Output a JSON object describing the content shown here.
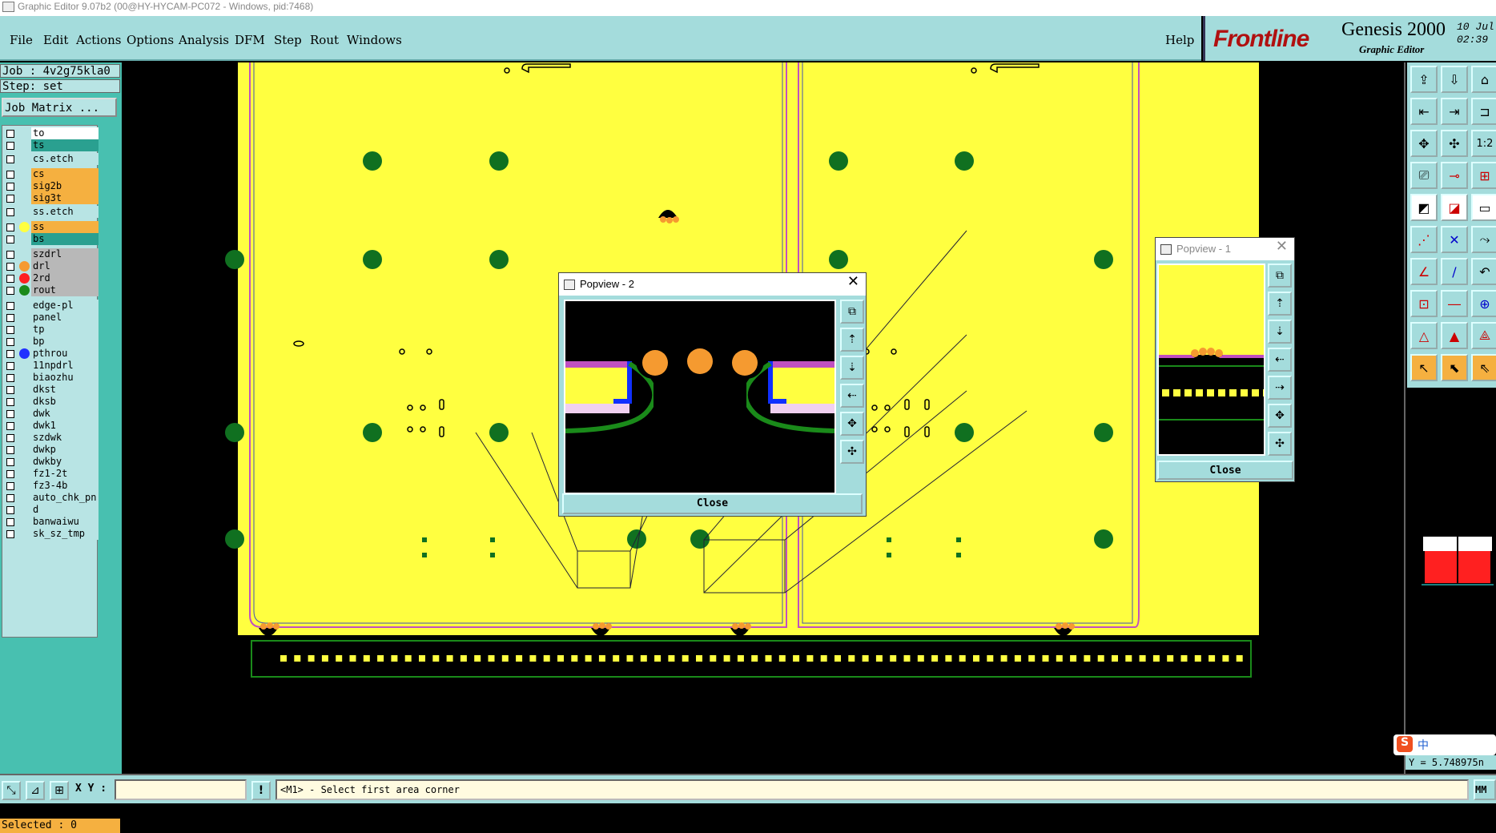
{
  "window": {
    "title": "Graphic Editor 9.07b2 (00@HY-HYCAM-PC072 - Windows, pid:7468)"
  },
  "menu": {
    "items": [
      "File",
      "Edit",
      "Actions",
      "Options",
      "Analysis",
      "DFM",
      "Step",
      "Rout",
      "Windows"
    ],
    "help": "Help"
  },
  "brand": {
    "logo": "Frontline",
    "product": "Genesis 2000",
    "subtitle": "Graphic Editor",
    "date": "10 Jul",
    "time": "02:39"
  },
  "left": {
    "job": "Job : 4v2g75kla0",
    "step": "Step: set",
    "matrix_button": "Job Matrix ...",
    "layers": [
      {
        "name": "to",
        "bg": "#ffffff",
        "dot": ""
      },
      {
        "name": "ts",
        "bg": "#2aa090",
        "dot": ""
      },
      {
        "name": "cs.etch",
        "bg": "#b8e4e4",
        "dot": ""
      },
      {
        "name": "cs",
        "bg": "#f5b040",
        "dot": ""
      },
      {
        "name": "sig2b",
        "bg": "#f5b040",
        "dot": ""
      },
      {
        "name": "sig3t",
        "bg": "#f5b040",
        "dot": ""
      },
      {
        "name": "ss.etch",
        "bg": "#b8e4e4",
        "dot": ""
      },
      {
        "name": "ss",
        "bg": "#f5b040",
        "dot": "#ffff40"
      },
      {
        "name": "bs",
        "bg": "#2aa090",
        "dot": ""
      },
      {
        "name": "szdrl",
        "bg": "#b8b8b8",
        "dot": ""
      },
      {
        "name": "drl",
        "bg": "#b8b8b8",
        "dot": "#f59a30"
      },
      {
        "name": "2rd",
        "bg": "#b8b8b8",
        "dot": "#ff2020"
      },
      {
        "name": "rout",
        "bg": "#b8b8b8",
        "dot": "#1a8a1a"
      },
      {
        "name": "edge-pl",
        "bg": "#b8e4e4",
        "dot": ""
      },
      {
        "name": "panel",
        "bg": "#b8e4e4",
        "dot": ""
      },
      {
        "name": "tp",
        "bg": "#b8e4e4",
        "dot": ""
      },
      {
        "name": "bp",
        "bg": "#b8e4e4",
        "dot": ""
      },
      {
        "name": "pthrou",
        "bg": "#b8e4e4",
        "dot": "#2030ff"
      },
      {
        "name": "11npdrl",
        "bg": "#b8e4e4",
        "dot": ""
      },
      {
        "name": "biaozhu",
        "bg": "#b8e4e4",
        "dot": ""
      },
      {
        "name": "dkst",
        "bg": "#b8e4e4",
        "dot": ""
      },
      {
        "name": "dksb",
        "bg": "#b8e4e4",
        "dot": ""
      },
      {
        "name": "dwk",
        "bg": "#b8e4e4",
        "dot": ""
      },
      {
        "name": "dwk1",
        "bg": "#b8e4e4",
        "dot": ""
      },
      {
        "name": "szdwk",
        "bg": "#b8e4e4",
        "dot": ""
      },
      {
        "name": "dwkp",
        "bg": "#b8e4e4",
        "dot": ""
      },
      {
        "name": "dwkby",
        "bg": "#b8e4e4",
        "dot": ""
      },
      {
        "name": "fz1-2t",
        "bg": "#b8e4e4",
        "dot": ""
      },
      {
        "name": "fz3-4b",
        "bg": "#b8e4e4",
        "dot": ""
      },
      {
        "name": "auto_chk_pn",
        "bg": "#b8e4e4",
        "dot": ""
      },
      {
        "name": "d",
        "bg": "#b8e4e4",
        "dot": ""
      },
      {
        "name": "banwaiwu",
        "bg": "#b8e4e4",
        "dot": ""
      },
      {
        "name": "sk_sz_tmp",
        "bg": "#b8e4e4",
        "dot": ""
      }
    ],
    "selected": "Selected : 0"
  },
  "popview2": {
    "title": "Popview - 2",
    "close": "Close"
  },
  "popview1": {
    "title": "Popview - 1",
    "close": "Close"
  },
  "right": {
    "y_readout": "Y = 5.748975n",
    "ime": "中"
  },
  "bottom": {
    "xy_label": "X Y :",
    "xy_value": "",
    "message": "<M1> - Select first area corner",
    "units": "MM"
  }
}
